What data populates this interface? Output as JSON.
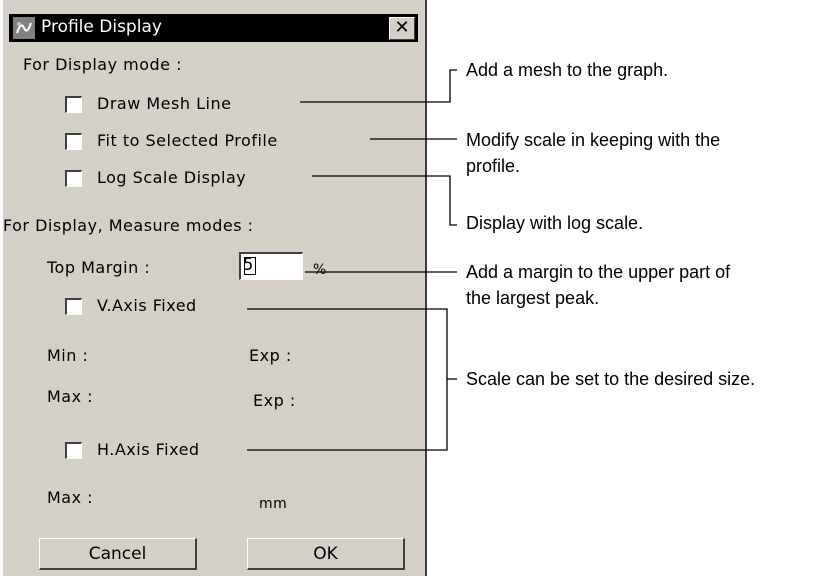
{
  "dialog": {
    "title": "Profile Display",
    "close_label": "✕",
    "display_mode_heading": "For Display mode :",
    "draw_mesh_line": "Draw Mesh Line",
    "fit_to_selected_profile": "Fit to Selected Profile",
    "log_scale_display": "Log Scale Display",
    "display_measure_heading": "For Display, Measure modes :",
    "top_margin_label": "Top Margin :",
    "top_margin_value": "5",
    "top_margin_unit": "%",
    "v_axis_fixed": "V.Axis Fixed",
    "min_label": "Min :",
    "exp_label_1": "Exp :",
    "max_label_1": "Max :",
    "exp_label_2": "Exp :",
    "h_axis_fixed": "H.Axis Fixed",
    "max_label_2": "Max :",
    "mm_label": "mm",
    "cancel": "Cancel",
    "ok": "OK"
  },
  "annotations": {
    "mesh": "Add a mesh to the graph.",
    "scale_line1": "Modify scale in keeping with the",
    "scale_line2": "profile.",
    "log": "Display with log scale.",
    "margin_line1": "Add a margin to the upper part of",
    "margin_line2": "the largest peak.",
    "axis": "Scale can be set to the desired size."
  }
}
